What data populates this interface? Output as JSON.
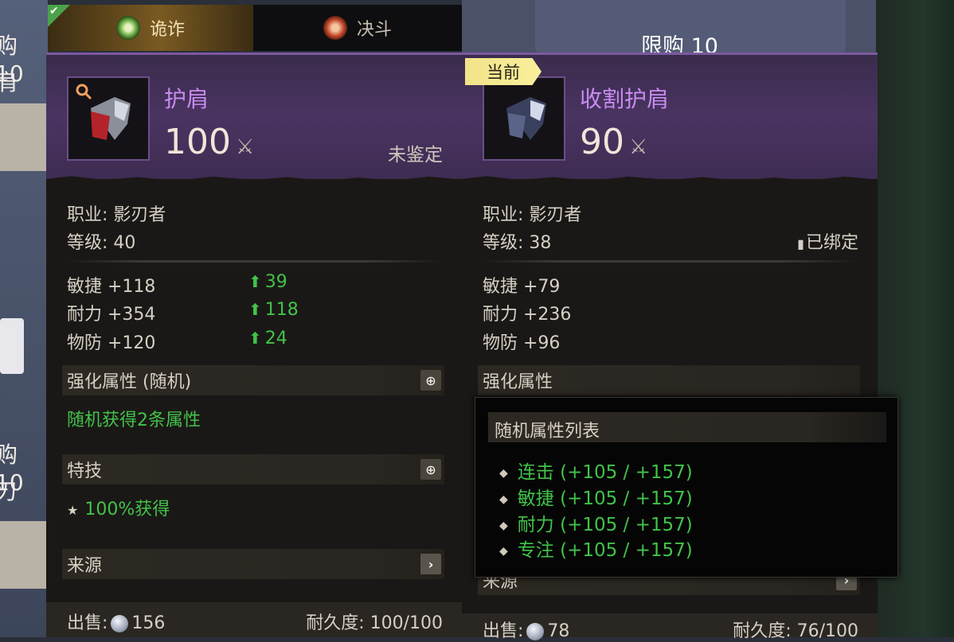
{
  "background": {
    "left_texts": [
      "购 10",
      "肩",
      "购 10",
      "刃"
    ],
    "top_right_limit": "限购 10"
  },
  "tabs": [
    {
      "label": "诡诈",
      "active": true
    },
    {
      "label": "决斗",
      "active": false
    }
  ],
  "left_item": {
    "name": "护肩",
    "power": "100",
    "status": "未鉴定",
    "class_line": "职业: 影刃者",
    "level_line": "等级: 40",
    "stats": [
      {
        "label": "敏捷 +118",
        "diff": "39"
      },
      {
        "label": "耐力 +354",
        "diff": "118"
      },
      {
        "label": "物防 +120",
        "diff": "24"
      }
    ],
    "enhance_title": "强化属性 (随机)",
    "enhance_text": "随机获得2条属性",
    "skill_title": "特技",
    "skill_text": "100%获得",
    "source_title": "来源",
    "sell_label": "出售:",
    "sell_value": "156",
    "durability": "耐久度: 100/100"
  },
  "right_item": {
    "badge": "当前",
    "name": "收割护肩",
    "power": "90",
    "class_line": "职业: 影刃者",
    "level_line": "等级: 38",
    "bound": "已绑定",
    "stats": [
      "敏捷 +79",
      "耐力 +236",
      "物防 +96"
    ],
    "enhance_title": "强化属性",
    "source_title": "来源",
    "sell_label": "出售:",
    "sell_value": "78",
    "durability": "耐久度: 76/100"
  },
  "popup": {
    "title": "随机属性列表",
    "items": [
      "连击 (+105 / +157)",
      "敏捷 (+105 / +157)",
      "耐力 (+105 / +157)",
      "专注 (+105 / +157)"
    ]
  },
  "colors": {
    "rare_name": "#c88cf0",
    "green": "#42c24a",
    "badge": "#f3e38a"
  }
}
